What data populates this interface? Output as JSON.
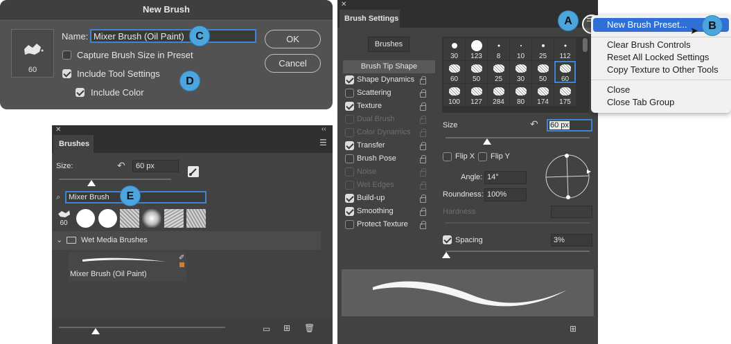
{
  "dialog": {
    "title": "New Brush",
    "preview_size": "60",
    "name_label": "Name:",
    "name_value": "Mixer Brush (Oil Paint)",
    "capture_label": "Capture Brush Size in Preset",
    "capture_checked": false,
    "include_tool_label": "Include Tool Settings",
    "include_tool_checked": true,
    "include_color_label": "Include Color",
    "include_color_checked": true,
    "ok_label": "OK",
    "cancel_label": "Cancel"
  },
  "callouts": {
    "a": "A",
    "b": "B",
    "c": "C",
    "d": "D",
    "e": "E"
  },
  "brushes_panel": {
    "tab": "Brushes",
    "size_label": "Size:",
    "size_value": "60 px",
    "search_value": "Mixer Brush",
    "first_preset_size": "60",
    "group_name": "Wet Media Brushes",
    "preset_name": "Mixer Brush (Oil Paint)",
    "accent_color": "#e07a1f"
  },
  "brush_settings": {
    "tab": "Brush Settings",
    "brushes_button": "Brushes",
    "tip_shape_label": "Brush Tip Shape",
    "options": [
      {
        "label": "Shape Dynamics",
        "checked": true,
        "enabled": true
      },
      {
        "label": "Scattering",
        "checked": false,
        "enabled": true
      },
      {
        "label": "Texture",
        "checked": true,
        "enabled": true
      },
      {
        "label": "Dual Brush",
        "checked": false,
        "enabled": false
      },
      {
        "label": "Color Dynamics",
        "checked": false,
        "enabled": false
      },
      {
        "label": "Transfer",
        "checked": true,
        "enabled": true
      },
      {
        "label": "Brush Pose",
        "checked": false,
        "enabled": true
      },
      {
        "label": "Noise",
        "checked": false,
        "enabled": false
      },
      {
        "label": "Wet Edges",
        "checked": false,
        "enabled": false
      },
      {
        "label": "Build-up",
        "checked": true,
        "enabled": true
      },
      {
        "label": "Smoothing",
        "checked": true,
        "enabled": true
      },
      {
        "label": "Protect Texture",
        "checked": false,
        "enabled": true
      }
    ],
    "tip_sizes_row1": [
      "30",
      "123",
      "8",
      "10",
      "25",
      "112"
    ],
    "tip_sizes_row2": [
      "60",
      "50",
      "25",
      "30",
      "50",
      "60"
    ],
    "tip_sizes_row3": [
      "100",
      "127",
      "284",
      "80",
      "174",
      "175"
    ],
    "size_label": "Size",
    "size_value": "60 px",
    "flip_x": "Flip X",
    "flip_y": "Flip Y",
    "angle_label": "Angle:",
    "angle_value": "14°",
    "roundness_label": "Roundness:",
    "roundness_value": "100%",
    "hardness_label": "Hardness",
    "spacing_label": "Spacing",
    "spacing_checked": true,
    "spacing_value": "3%"
  },
  "flyout_menu": {
    "items": [
      "New Brush Preset...",
      "Clear Brush Controls",
      "Reset All Locked Settings",
      "Copy Texture to Other Tools",
      "Close",
      "Close Tab Group"
    ],
    "highlight_color": "#2f6fd6"
  }
}
